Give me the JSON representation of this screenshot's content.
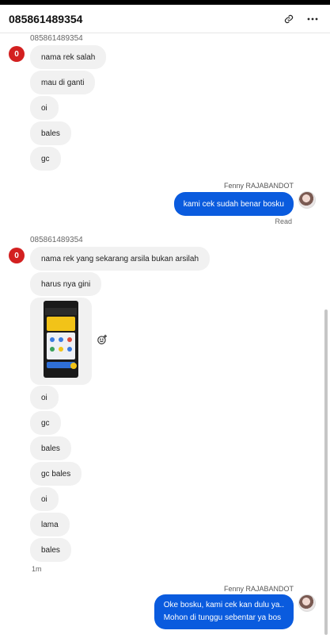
{
  "header": {
    "title": "085861489354",
    "link_icon": "link-icon",
    "more_icon": "more-horizontal-icon"
  },
  "group1": {
    "sender": "085861489354",
    "avatar_label": "0",
    "messages": [
      "nama rek salah",
      "mau di ganti",
      "oi",
      "bales",
      "gc"
    ]
  },
  "reply1": {
    "agent": "Fenny RAJABANDOT",
    "text": "kami cek sudah benar bosku",
    "status": "Read"
  },
  "group2": {
    "sender": "085861489354",
    "avatar_label": "0",
    "messages_before_image": [
      "nama rek yang sekarang arsila bukan arsilah",
      "harus nya gini"
    ],
    "messages_after_image": [
      "oi",
      "gc",
      "bales",
      "gc bales",
      "oi",
      "lama",
      "bales"
    ],
    "timestamp": "1m"
  },
  "reply2": {
    "agent": "Fenny RAJABANDOT",
    "line1": "Oke bosku, kami cek kan dulu ya..",
    "line2": "Mohon di tunggu sebentar ya bos"
  },
  "colors": {
    "outgoing": "#0a5bde",
    "incoming": "#f1f1f1",
    "badge": "#d32020"
  }
}
